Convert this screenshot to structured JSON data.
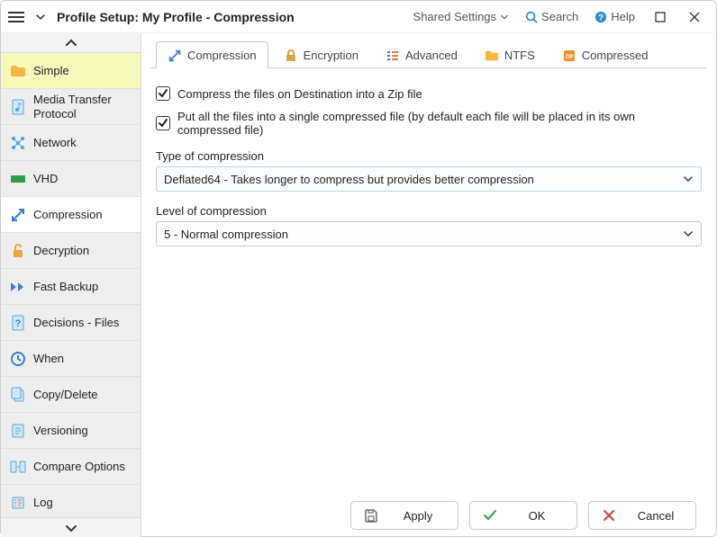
{
  "titlebar": {
    "title": "Profile Setup: My Profile - Compression",
    "shared_settings": "Shared Settings",
    "search": "Search",
    "help": "Help"
  },
  "sidebar": {
    "items": [
      {
        "label": "Simple"
      },
      {
        "label": "Media Transfer Protocol"
      },
      {
        "label": "Network"
      },
      {
        "label": "VHD"
      },
      {
        "label": "Compression"
      },
      {
        "label": "Decryption"
      },
      {
        "label": "Fast Backup"
      },
      {
        "label": "Decisions - Files"
      },
      {
        "label": "When"
      },
      {
        "label": "Copy/Delete"
      },
      {
        "label": "Versioning"
      },
      {
        "label": "Compare Options"
      },
      {
        "label": "Log"
      }
    ]
  },
  "tabs": {
    "compression": "Compression",
    "encryption": "Encryption",
    "advanced": "Advanced",
    "ntfs": "NTFS",
    "compressed": "Compressed"
  },
  "form": {
    "chk_compress": "Compress the files on Destination into a Zip file",
    "chk_single": "Put all the files into a single compressed file (by default each file will be placed in its own compressed file)",
    "type_label": "Type of compression",
    "type_value": "Deflated64 - Takes longer to compress but provides better compression",
    "level_label": "Level of compression",
    "level_value": "5 - Normal compression"
  },
  "footer": {
    "apply": "Apply",
    "ok": "OK",
    "cancel": "Cancel"
  }
}
